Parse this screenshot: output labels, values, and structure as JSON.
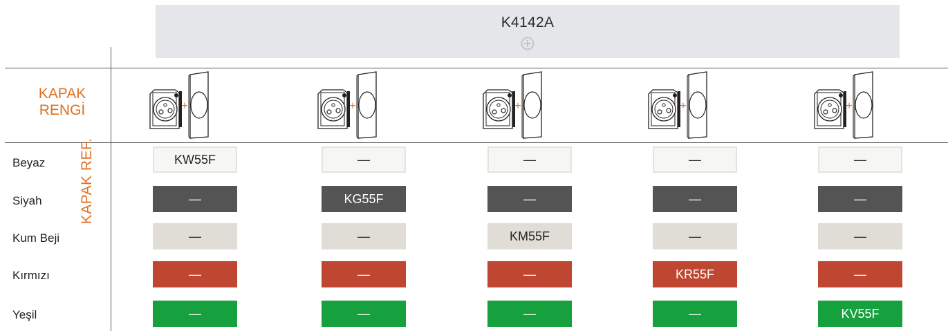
{
  "header": {
    "title": "K4142A",
    "plus_icon": "circle-plus-icon"
  },
  "cover_color_label": [
    "KAPAK",
    "RENGİ"
  ],
  "cover_ref_label": "KAPAK REF.",
  "colors": {
    "accent": "#e07022",
    "white": "#f6f6f3",
    "black": "#545454",
    "beige": "#e0ddd7",
    "red": "#bf4731",
    "green": "#17a03e"
  },
  "product_icon": "socket-plus-cover-icon",
  "product_plus": "+",
  "rows": [
    {
      "label": "Beyaz",
      "cells": [
        "KW55F",
        "—",
        "—",
        "—",
        "—"
      ]
    },
    {
      "label": "Siyah",
      "cells": [
        "—",
        "KG55F",
        "—",
        "—",
        "—"
      ]
    },
    {
      "label": "Kum Beji",
      "cells": [
        "—",
        "—",
        "KM55F",
        "—",
        "—"
      ]
    },
    {
      "label": "Kırmızı",
      "cells": [
        "—",
        "—",
        "—",
        "KR55F",
        "—"
      ]
    },
    {
      "label": "Yeşil",
      "cells": [
        "—",
        "—",
        "—",
        "—",
        "KV55F"
      ]
    }
  ]
}
